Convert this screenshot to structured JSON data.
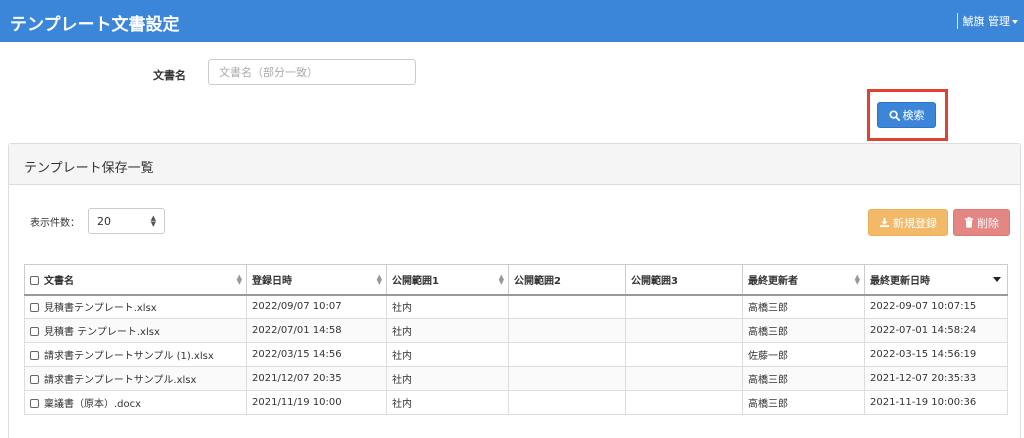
{
  "header": {
    "title": "テンプレート文書設定",
    "user_menu_label": "鯱旗 管理"
  },
  "filter": {
    "doc_name_label": "文書名",
    "doc_name_placeholder": "文書名（部分一致）",
    "doc_name_value": "",
    "search_button_label": "検索"
  },
  "panel": {
    "title": "テンプレート保存一覧",
    "page_size_label": "表示件数：",
    "page_size_value": "20",
    "new_button_label": "新規登録",
    "delete_button_label": "削除"
  },
  "table": {
    "columns": [
      "文書名",
      "登録日時",
      "公開範囲1",
      "公開範囲2",
      "公開範囲3",
      "最終更新者",
      "最終更新日時"
    ],
    "rows": [
      [
        "見積書テンプレート.xlsx",
        "2022/09/07 10:07",
        "社内",
        "",
        "",
        "高橋三郎",
        "2022-09-07 10:07:15"
      ],
      [
        "見積書 テンプレート.xlsx",
        "2022/07/01 14:58",
        "社内",
        "",
        "",
        "高橋三郎",
        "2022-07-01 14:58:24"
      ],
      [
        "請求書テンプレートサンプル (1).xlsx",
        "2022/03/15 14:56",
        "社内",
        "",
        "",
        "佐藤一郎",
        "2022-03-15 14:56:19"
      ],
      [
        "請求書テンプレートサンプル.xlsx",
        "2021/12/07 20:35",
        "社内",
        "",
        "",
        "高橋三郎",
        "2021-12-07 20:35:33"
      ],
      [
        "稟議書（原本）.docx",
        "2021/11/19 10:00",
        "社内",
        "",
        "",
        "高橋三郎",
        "2021-11-19 10:00:36"
      ]
    ]
  },
  "colors": {
    "brand": "#3b86d9",
    "warning": "#f0ad4e",
    "danger": "#d9534f",
    "highlight": "#e2412f"
  },
  "icons": {
    "search": "search-icon",
    "new": "download-icon",
    "delete": "trash-icon"
  }
}
